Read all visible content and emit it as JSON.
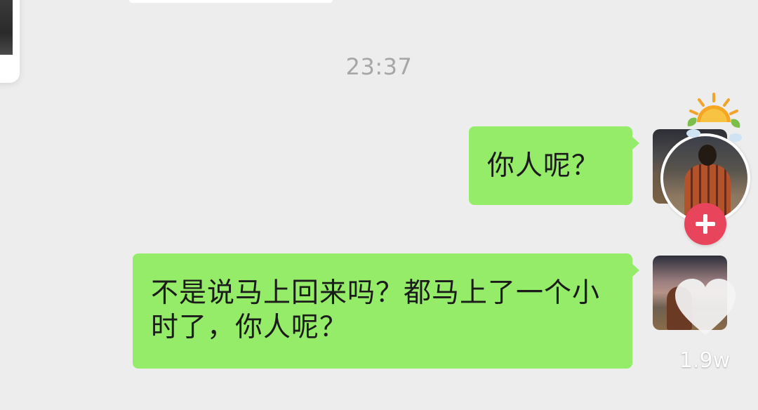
{
  "chat": {
    "timestamp": "23:37",
    "messages": [
      {
        "sender": "self",
        "text": "你人呢？"
      },
      {
        "sender": "self",
        "text": "不是说马上回来吗？都马上了一个小时了，你人呢？"
      }
    ]
  },
  "video_overlay": {
    "like_count": "1.9w",
    "follow_icon": "plus-icon",
    "like_icon": "heart-icon"
  },
  "colors": {
    "background": "#ededed",
    "bubble_green": "#95ec69",
    "follow_red": "#e8455d",
    "timestamp_gray": "#a6a6a6"
  }
}
